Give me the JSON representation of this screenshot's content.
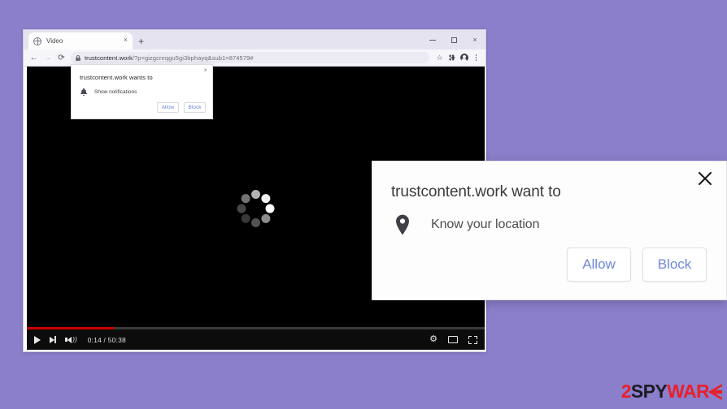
{
  "colors": {
    "background": "#8b7fcc",
    "accent_link": "#6e88dd",
    "progress_played": "#cc0000",
    "logo_red": "#e8202a",
    "logo_dark": "#1c1c24"
  },
  "browser": {
    "tab": {
      "title": "Video",
      "favicon": "globe-icon",
      "close": "×",
      "newtab": "+"
    },
    "window_controls": {
      "minimize": "minimize-icon",
      "maximize": "maximize-icon",
      "close": "×"
    },
    "toolbar": {
      "back": "←",
      "forward": "→",
      "reload": "⟳",
      "lock": "lock-icon",
      "url_host": "trustcontent.work",
      "url_path": "/?p=gizgcnrqgu5gi3bphayq&sub1=874579#",
      "url_full": "trustcontent.work/?p=gizgcnrqgu5gi3bphayq&sub1=874579#",
      "bookmark": "☆",
      "extensions": "puzzle-piece-icon",
      "profile": "avatar-icon",
      "menu": "three-dot-menu-icon"
    }
  },
  "video": {
    "state": "loading",
    "spinner": "loading-spinner",
    "progress_percent": 19,
    "controls": {
      "play": "play-icon",
      "next": "next-track-icon",
      "volume": "volume-icon",
      "time": "0:14 / 50:38",
      "current_time": "0:14",
      "duration": "50:38",
      "settings": "⚙",
      "theater": "theater-mode-icon",
      "fullscreen": "fullscreen-icon"
    }
  },
  "small_popup": {
    "title": "trustcontent.work wants to",
    "permission_icon": "bell-icon",
    "permission_label": "Show notifications",
    "allow_label": "Allow",
    "block_label": "Block",
    "close": "×"
  },
  "big_popup": {
    "title": "trustcontent.work want to",
    "permission_icon": "location-pin-icon",
    "permission_label": "Know your location",
    "allow_label": "Allow",
    "block_label": "Block",
    "close": "×"
  },
  "logo": {
    "part1": "2",
    "part2": "SPY",
    "part3": "WAR",
    "part4": "E",
    "full": "2SPYWARE"
  }
}
